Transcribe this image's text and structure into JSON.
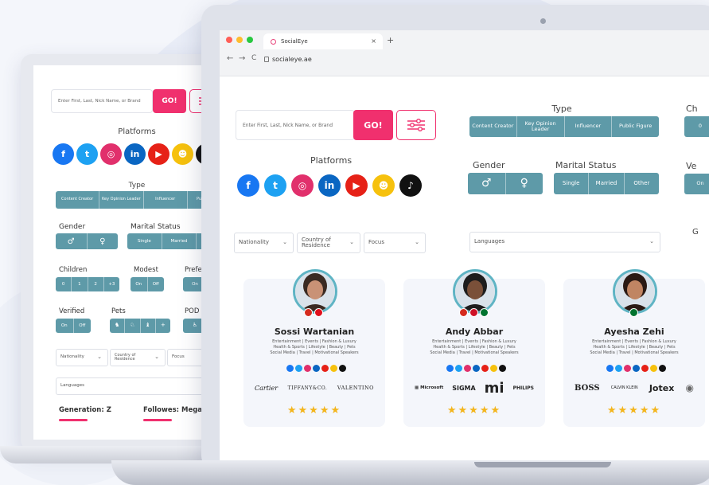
{
  "browser": {
    "tab_title": "SocialEye",
    "url": "socialeye.ae",
    "close_glyph": "×",
    "new_tab_glyph": "+",
    "back_glyph": "←",
    "forward_glyph": "→",
    "reload_glyph": "C"
  },
  "search": {
    "placeholder": "Enter First, Last, Nick Name, or Brand",
    "go_label": "GO!"
  },
  "platforms": {
    "title": "Platforms",
    "icons": [
      {
        "name": "facebook-icon",
        "glyph": "f",
        "color": "#1877f2"
      },
      {
        "name": "twitter-icon",
        "glyph": "t",
        "color": "#1da1f2"
      },
      {
        "name": "instagram-icon",
        "glyph": "◎",
        "color": "#e1306c"
      },
      {
        "name": "linkedin-icon",
        "glyph": "in",
        "color": "#0a66c2"
      },
      {
        "name": "youtube-icon",
        "glyph": "▶",
        "color": "#e62117"
      },
      {
        "name": "snapchat-icon",
        "glyph": "☻",
        "color": "#f6c10d"
      },
      {
        "name": "tiktok-icon",
        "glyph": "♪",
        "color": "#111111"
      }
    ]
  },
  "type": {
    "title": "Type",
    "options": [
      "Content Creator",
      "Key Opinion Leader",
      "Influencer",
      "Public Figure"
    ]
  },
  "gender": {
    "title": "Gender",
    "male_glyph": "♂",
    "female_glyph": "♀"
  },
  "marital": {
    "title": "Marital Status",
    "options": [
      "Single",
      "Married",
      "Other"
    ]
  },
  "cut": {
    "ch": "Ch",
    "ch_value": "0",
    "ve": "Ve",
    "ve_value": "On",
    "g": "G"
  },
  "filters": {
    "nationality": "Nationality",
    "country": "Country of Residence",
    "focus": "Focus",
    "languages": "Languages",
    "caret": "⌄"
  },
  "back": {
    "children": {
      "title": "Children",
      "options": [
        "0",
        "1",
        "2",
        "+3"
      ]
    },
    "modest": {
      "title": "Modest",
      "options": [
        "On",
        "Off"
      ]
    },
    "pref": {
      "title": "Prefe",
      "value": "On"
    },
    "verified": {
      "title": "Verified",
      "options": [
        "On",
        "Off"
      ]
    },
    "pets": {
      "title": "Pets",
      "plus": "+"
    },
    "pod": {
      "title": "POD"
    },
    "generation": "Generation: Z",
    "follows": "Followes: Mega"
  },
  "influencers": [
    {
      "name": "Sossi Wartanian",
      "tags": [
        "Entertainment | Events | Fashion & Luxury",
        "Health & Sports | Lifestyle | Beauty | Pets",
        "Social Media | Travel | Motivational Speakers"
      ],
      "brands": [
        "Cartier",
        "TIFFANY&CO.",
        "VALENTINO"
      ],
      "flags": [
        "#d52b1e",
        "#e0101c"
      ],
      "skin": "#c99276",
      "hair": "#3a2a22",
      "rating": "★★★★★"
    },
    {
      "name": "Andy Abbar",
      "tags": [
        "Entertainment | Events | Fashion & Luxury",
        "Health & Sports | Lifestyle | Beauty | Pets",
        "Social Media | Travel | Motivational Speakers"
      ],
      "brands": [
        "▦ Microsoft",
        "SIGMA",
        "mi",
        "PHILIPS"
      ],
      "flags": [
        "#d52b1e",
        "#ce1126",
        "#00732f"
      ],
      "skin": "#7a5039",
      "hair": "#1d1d1d",
      "rating": "★★★★★"
    },
    {
      "name": "Ayesha Zehi",
      "tags": [
        "Entertainment | Events | Fashion & Luxury",
        "Health & Sports | Lifestyle | Beauty | Pets",
        "Social Media | Travel | Motivational Speakers"
      ],
      "brands": [
        "BOSS",
        "CALVIN KLEIN",
        "Jotex",
        "◉"
      ],
      "flags": [
        "#00732f"
      ],
      "skin": "#c08563",
      "hair": "#2a1a14",
      "rating": "★★★★★"
    }
  ],
  "mini_social_colors": [
    "#1877f2",
    "#1da1f2",
    "#e1306c",
    "#0a66c2",
    "#e62117",
    "#f6c10d",
    "#111111"
  ]
}
